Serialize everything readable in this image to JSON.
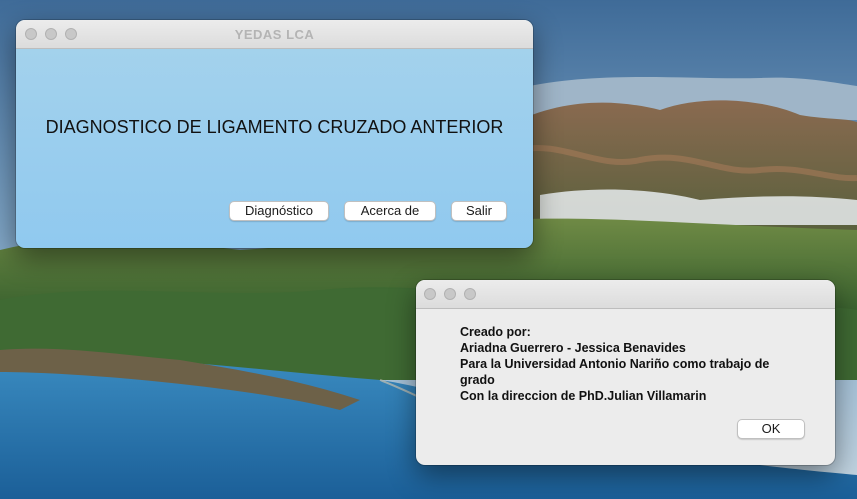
{
  "main_window": {
    "title": "YEDAS LCA",
    "heading": "DIAGNOSTICO DE LIGAMENTO CRUZADO ANTERIOR",
    "buttons": {
      "diagnostico": "Diagnóstico",
      "acerca_de": "Acerca de",
      "salir": "Salir"
    }
  },
  "about_dialog": {
    "title": "",
    "lines": [
      "Creado por:",
      "Ariadna Guerrero - Jessica Benavides",
      "Para la Universidad Antonio Nariño como trabajo de grado",
      "Con la direccion de PhD.Julian Villamarin"
    ],
    "ok_label": "OK"
  },
  "colors": {
    "main_bg_top": "#a6d3ec",
    "main_bg_bottom": "#90c9ef",
    "dialog_bg": "#ececec",
    "titlebar": "#e3e3e3"
  }
}
